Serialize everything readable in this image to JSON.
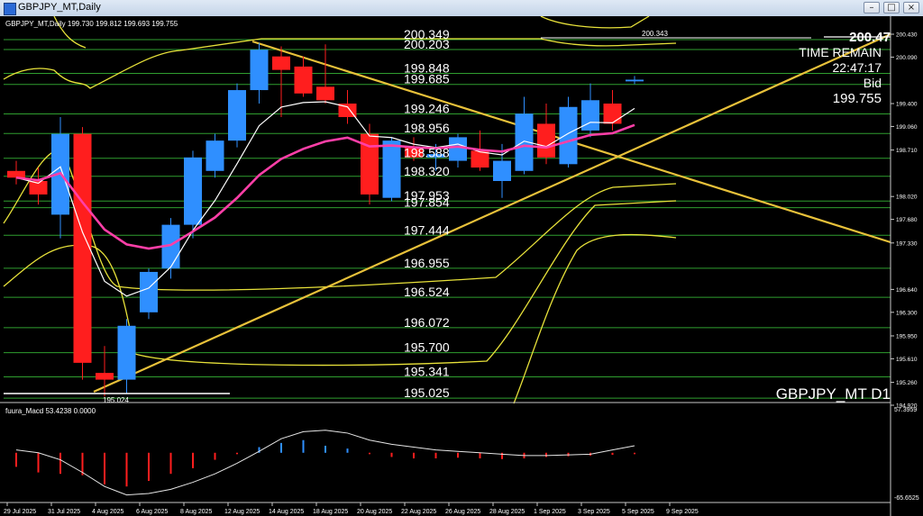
{
  "window": {
    "title": "GBPJPY_MT,Daily",
    "minimize_glyph": "–",
    "maximize_glyph": "□",
    "close_glyph": "×"
  },
  "chart": {
    "header": "GBPJPY_MT,Daily  199.730 199.812 199.693 199.755",
    "symbol_label": "GBPJPY_MT D1",
    "current_price": "200.47",
    "time_remain_label": "TIME REMAIN",
    "time_remain_value": "22:47:17",
    "bid_label": "Bid",
    "bid_value": "199.755",
    "high_marker": "200.343",
    "low_marker": "195.024",
    "levels": [
      {
        "label": "200.349",
        "price": 200.349
      },
      {
        "label": "200.203",
        "price": 200.203
      },
      {
        "label": "199.848",
        "price": 199.848
      },
      {
        "label": "199.685",
        "price": 199.685
      },
      {
        "label": "199.246",
        "price": 199.246
      },
      {
        "label": "198.956",
        "price": 198.956
      },
      {
        "label": "198.588",
        "price": 198.588
      },
      {
        "label": "198.320",
        "price": 198.32
      },
      {
        "label": "197.953",
        "price": 197.953
      },
      {
        "label": "197.854",
        "price": 197.854
      },
      {
        "label": "197.444",
        "price": 197.444
      },
      {
        "label": "196.955",
        "price": 196.955
      },
      {
        "label": "196.524",
        "price": 196.524
      },
      {
        "label": "196.072",
        "price": 196.072
      },
      {
        "label": "195.700",
        "price": 195.7
      },
      {
        "label": "195.341",
        "price": 195.341
      },
      {
        "label": "195.025",
        "price": 195.025
      }
    ],
    "axis_ticks": [
      {
        "label": "200.430",
        "price": 200.43
      },
      {
        "label": "200.090",
        "price": 200.09
      },
      {
        "label": "199.400",
        "price": 199.4
      },
      {
        "label": "199.060",
        "price": 199.06
      },
      {
        "label": "198.710",
        "price": 198.71
      },
      {
        "label": "198.020",
        "price": 198.02
      },
      {
        "label": "197.680",
        "price": 197.68
      },
      {
        "label": "197.330",
        "price": 197.33
      },
      {
        "label": "196.640",
        "price": 196.64
      },
      {
        "label": "196.300",
        "price": 196.3
      },
      {
        "label": "195.950",
        "price": 195.95
      },
      {
        "label": "195.610",
        "price": 195.61
      },
      {
        "label": "195.260",
        "price": 195.26
      },
      {
        "label": "194.920",
        "price": 194.92
      }
    ],
    "colors": {
      "bull": "#2f8fff",
      "bear": "#ff1e1e",
      "level": "#2f9e2f",
      "trend": "#e8c13a",
      "ma_fast": "#ff3fa8",
      "ma_slow": "#ffffff",
      "band": "#e8e23a"
    },
    "candles": [
      {
        "o": 198.4,
        "h": 198.55,
        "l": 198.2,
        "c": 198.3
      },
      {
        "o": 198.25,
        "h": 198.45,
        "l": 197.9,
        "c": 198.05
      },
      {
        "o": 197.75,
        "h": 199.2,
        "l": 197.4,
        "c": 198.95
      },
      {
        "o": 198.95,
        "h": 199.05,
        "l": 195.3,
        "c": 195.55
      },
      {
        "o": 195.4,
        "h": 195.8,
        "l": 195.05,
        "c": 195.3
      },
      {
        "o": 195.3,
        "h": 196.2,
        "l": 195.1,
        "c": 196.1
      },
      {
        "o": 196.3,
        "h": 196.95,
        "l": 196.2,
        "c": 196.9
      },
      {
        "o": 196.95,
        "h": 197.7,
        "l": 196.8,
        "c": 197.6
      },
      {
        "o": 197.6,
        "h": 198.7,
        "l": 197.4,
        "c": 198.6
      },
      {
        "o": 198.4,
        "h": 198.95,
        "l": 198.3,
        "c": 198.85
      },
      {
        "o": 198.85,
        "h": 199.7,
        "l": 198.75,
        "c": 199.6
      },
      {
        "o": 199.6,
        "h": 200.3,
        "l": 199.4,
        "c": 200.2
      },
      {
        "o": 200.1,
        "h": 200.25,
        "l": 199.2,
        "c": 199.9
      },
      {
        "o": 199.95,
        "h": 200.1,
        "l": 199.5,
        "c": 199.55
      },
      {
        "o": 199.65,
        "h": 200.28,
        "l": 199.4,
        "c": 199.45
      },
      {
        "o": 199.4,
        "h": 199.6,
        "l": 199.1,
        "c": 199.2
      },
      {
        "o": 198.95,
        "h": 199.1,
        "l": 197.9,
        "c": 198.05
      },
      {
        "o": 198.0,
        "h": 198.9,
        "l": 197.95,
        "c": 198.85
      },
      {
        "o": 198.75,
        "h": 198.9,
        "l": 198.55,
        "c": 198.6
      },
      {
        "o": 198.6,
        "h": 198.8,
        "l": 198.4,
        "c": 198.65
      },
      {
        "o": 198.55,
        "h": 198.95,
        "l": 198.45,
        "c": 198.9
      },
      {
        "o": 198.7,
        "h": 199.0,
        "l": 198.4,
        "c": 198.45
      },
      {
        "o": 198.25,
        "h": 198.8,
        "l": 198.0,
        "c": 198.55
      },
      {
        "o": 198.4,
        "h": 199.5,
        "l": 198.35,
        "c": 199.25
      },
      {
        "o": 199.1,
        "h": 199.4,
        "l": 198.5,
        "c": 198.6
      },
      {
        "o": 198.5,
        "h": 199.5,
        "l": 198.45,
        "c": 199.35
      },
      {
        "o": 199.0,
        "h": 199.7,
        "l": 198.9,
        "c": 199.45
      },
      {
        "o": 199.4,
        "h": 199.6,
        "l": 199.0,
        "c": 199.1
      },
      {
        "o": 199.73,
        "h": 199.81,
        "l": 199.69,
        "c": 199.755
      }
    ],
    "dates": [
      {
        "label": "29 Jul 2025",
        "i": 0
      },
      {
        "label": "31 Jul 2025",
        "i": 2
      },
      {
        "label": "4 Aug 2025",
        "i": 4
      },
      {
        "label": "6 Aug 2025",
        "i": 6
      },
      {
        "label": "8 Aug 2025",
        "i": 8
      },
      {
        "label": "12 Aug 2025",
        "i": 10
      },
      {
        "label": "14 Aug 2025",
        "i": 12
      },
      {
        "label": "18 Aug 2025",
        "i": 14
      },
      {
        "label": "20 Aug 2025",
        "i": 16
      },
      {
        "label": "22 Aug 2025",
        "i": 18
      },
      {
        "label": "26 Aug 2025",
        "i": 20
      },
      {
        "label": "28 Aug 2025",
        "i": 22
      },
      {
        "label": "1 Sep 2025",
        "i": 24
      },
      {
        "label": "3 Sep 2025",
        "i": 26
      },
      {
        "label": "5 Sep 2025",
        "i": 28
      },
      {
        "label": "9 Sep 2025",
        "i": 30
      }
    ],
    "macd": {
      "label": "fuura_Macd 53.4238   0.0000",
      "top_label": "57.3959",
      "bottom_label": "-65.6525",
      "max": 57.3959,
      "min": -65.6525,
      "hist": [
        -20,
        -28,
        -30,
        -32,
        -45,
        -48,
        -40,
        -30,
        -22,
        -10,
        -2,
        8,
        14,
        18,
        10,
        6,
        -2,
        -6,
        -8,
        -8,
        -7,
        -8,
        -9,
        -8,
        -6,
        -5,
        -4,
        -3,
        -2
      ],
      "signal": [
        4,
        0,
        -10,
        -28,
        -48,
        -60,
        -58,
        -52,
        -42,
        -30,
        -15,
        2,
        20,
        30,
        32,
        28,
        18,
        12,
        8,
        4,
        2,
        0,
        -2,
        -4,
        -4,
        -3,
        -2,
        4,
        10
      ]
    }
  }
}
